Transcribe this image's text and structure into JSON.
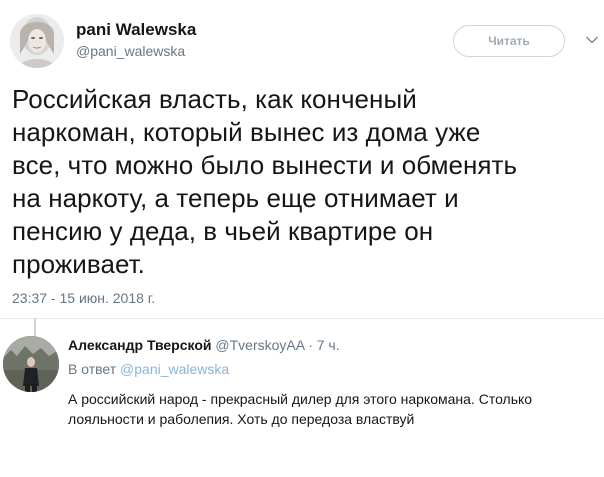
{
  "tweet": {
    "author_name": "pani Walewska",
    "author_handle": "@pani_walewska",
    "follow_label": "Читать",
    "text_lines": [
      "Российская власть, как конченый",
      "наркоман, который вынес из дома уже",
      "все, что можно было вынести и обменять",
      "на наркоту, а теперь еще отнимает и",
      "пенсию у деда, в чьей квартире он",
      "проживает."
    ],
    "timestamp": "23:37 - 15 июн. 2018 г."
  },
  "reply": {
    "author_name": "Александр Тверской",
    "author_handle": "@TverskoyAA",
    "separator": "·",
    "time_ago": "7 ч.",
    "reply_to_prefix": "В ответ",
    "reply_to_handle": "@pani_walewska",
    "text_lines": [
      "А российский народ - прекрасный дилер для этого наркомана. Столько",
      "лояльности и раболепия. Хоть до передоза властвуй"
    ]
  },
  "icons": {
    "more": "chevron-down-icon",
    "main_avatar": "avatar",
    "reply_avatar": "avatar"
  },
  "colors": {
    "text_primary": "#14171a",
    "text_secondary": "#657786",
    "mention": "#8ab4d8",
    "border": "#e6ecf0"
  }
}
